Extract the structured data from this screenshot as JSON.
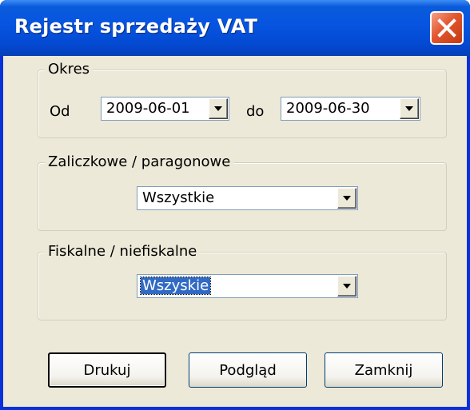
{
  "window": {
    "title": "Rejestr sprzedaży VAT",
    "close_icon": "close-icon"
  },
  "okres": {
    "legend": "Okres",
    "od_label": "Od",
    "od_value": "2009-06-01",
    "do_label": "do",
    "do_value": "2009-06-30"
  },
  "zaliczkowe": {
    "legend": "Zaliczkowe / paragonowe",
    "value": "Wszystkie"
  },
  "fiskalne": {
    "legend": "Fiskalne / niefiskalne",
    "value": "Wszyskie"
  },
  "buttons": {
    "print": "Drukuj",
    "preview": "Podgląd",
    "close": "Zamknij"
  },
  "colors": {
    "titlebar": "#0654e0",
    "selection": "#316ac5",
    "dialog_bg": "#ece9d8",
    "close_button": "#e2562f"
  }
}
